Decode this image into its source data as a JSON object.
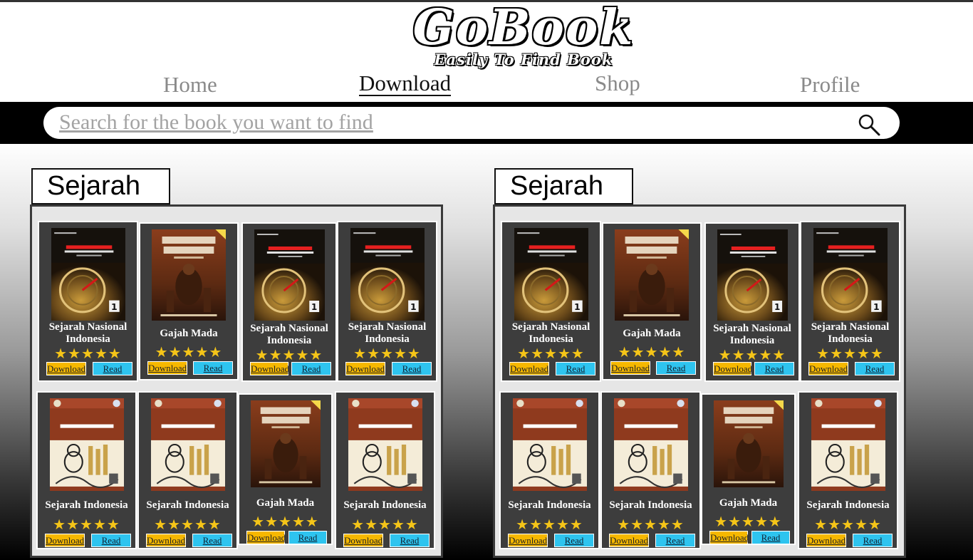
{
  "brand": {
    "name": "GoBook",
    "tagline": "Easily To Find Book"
  },
  "nav": {
    "home": "Home",
    "download": "Download",
    "shop": "Shop",
    "profile": "Profile",
    "active": "Download"
  },
  "search": {
    "placeholder": "Search for the book you want to find"
  },
  "colors": {
    "download_button": "#f6b800",
    "read_button": "#2ec4ef",
    "star": "#f5c518",
    "card": "#3d3d3d"
  },
  "sections": [
    {
      "label": "Sejarah",
      "books": [
        {
          "title": "Sejarah Nasional Indonesia",
          "cover": "sejarah-nasional",
          "rating": 5,
          "download": "Download",
          "read": "Read"
        },
        {
          "title": "Gajah Mada",
          "cover": "gajah-mada",
          "rating": 5,
          "download": "Download",
          "read": "Read"
        },
        {
          "title": "Sejarah Nasional Indonesia",
          "cover": "sejarah-nasional",
          "rating": 5,
          "download": "Download",
          "read": "Read"
        },
        {
          "title": "Sejarah Nasional Indonesia",
          "cover": "sejarah-nasional",
          "rating": 5,
          "download": "Download",
          "read": "Read"
        },
        {
          "title": "Sejarah Indonesia",
          "cover": "sejarah-indonesia",
          "rating": 5,
          "download": "Download",
          "read": "Read"
        },
        {
          "title": "Sejarah Indonesia",
          "cover": "sejarah-indonesia",
          "rating": 5,
          "download": "Download",
          "read": "Read"
        },
        {
          "title": "Gajah Mada",
          "cover": "gajah-mada",
          "rating": 5,
          "download": "Download",
          "read": "Read"
        },
        {
          "title": "Sejarah Indonesia",
          "cover": "sejarah-indonesia",
          "rating": 5,
          "download": "Download",
          "read": "Read"
        }
      ]
    },
    {
      "label": "Sejarah",
      "books": [
        {
          "title": "Sejarah Nasional Indonesia",
          "cover": "sejarah-nasional",
          "rating": 5,
          "download": "Download",
          "read": "Read"
        },
        {
          "title": "Gajah Mada",
          "cover": "gajah-mada",
          "rating": 5,
          "download": "Download",
          "read": "Read"
        },
        {
          "title": "Sejarah Nasional Indonesia",
          "cover": "sejarah-nasional",
          "rating": 5,
          "download": "Download",
          "read": "Read"
        },
        {
          "title": "Sejarah Nasional Indonesia",
          "cover": "sejarah-nasional",
          "rating": 5,
          "download": "Download",
          "read": "Read"
        },
        {
          "title": "Sejarah Indonesia",
          "cover": "sejarah-indonesia",
          "rating": 5,
          "download": "Download",
          "read": "Read"
        },
        {
          "title": "Sejarah Indonesia",
          "cover": "sejarah-indonesia",
          "rating": 5,
          "download": "Download",
          "read": "Read"
        },
        {
          "title": "Gajah Mada",
          "cover": "gajah-mada",
          "rating": 5,
          "download": "Download",
          "read": "Read"
        },
        {
          "title": "Sejarah Indonesia",
          "cover": "sejarah-indonesia",
          "rating": 5,
          "download": "Download",
          "read": "Read"
        }
      ]
    }
  ]
}
